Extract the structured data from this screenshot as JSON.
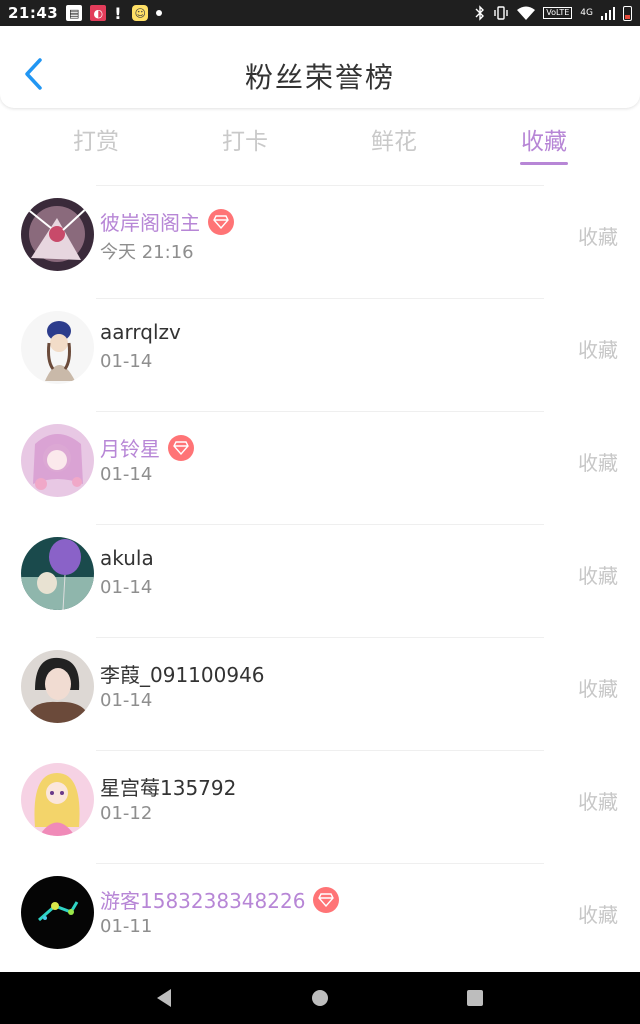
{
  "status_bar": {
    "time": "21:43",
    "left_icons": [
      "news-icon",
      "app-notification-icon",
      "alert-icon",
      "chat-icon",
      "dot-icon"
    ],
    "right_icons": [
      "bluetooth-icon",
      "vibrate-icon",
      "wifi-icon",
      "volte-icon",
      "signal-icon",
      "battery-icon"
    ],
    "volte": "VoLTE",
    "network": "4G"
  },
  "header": {
    "title": "粉丝荣誉榜",
    "back_icon": "chevron-left-icon",
    "accent_color": "#2196f3"
  },
  "tabs": [
    {
      "label": "打赏",
      "active": false
    },
    {
      "label": "打卡",
      "active": false
    },
    {
      "label": "鲜花",
      "active": false
    },
    {
      "label": "收藏",
      "active": true
    }
  ],
  "colors": {
    "active_purple": "#b786d6",
    "inactive_gray": "#c9c9c9",
    "badge_red": "#ff7476"
  },
  "fans": [
    {
      "name": "彼岸阁阁主",
      "date": "今天 21:16",
      "vip": true,
      "action": "收藏"
    },
    {
      "name": "aarrqlzv",
      "date": "01-14",
      "vip": false,
      "action": "收藏"
    },
    {
      "name": "月铃星",
      "date": "01-14",
      "vip": true,
      "action": "收藏"
    },
    {
      "name": "akula",
      "date": "01-14",
      "vip": false,
      "action": "收藏"
    },
    {
      "name": "李葭_091100946",
      "date": "01-14",
      "vip": false,
      "action": "收藏"
    },
    {
      "name": "星宫莓135792",
      "date": "01-12",
      "vip": false,
      "action": "收藏"
    },
    {
      "name": "游客1583238348226",
      "date": "01-11",
      "vip": true,
      "action": "收藏"
    }
  ],
  "nav_bar": {
    "buttons": [
      "back-triangle-icon",
      "home-circle-icon",
      "recents-square-icon"
    ]
  }
}
